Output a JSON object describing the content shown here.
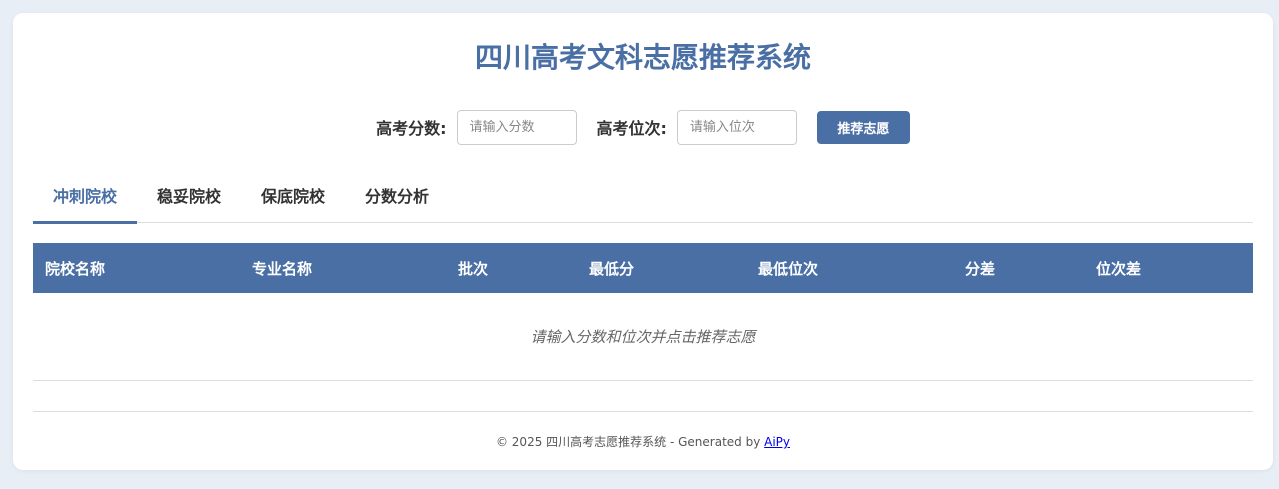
{
  "header": {
    "title": "四川高考文科志愿推荐系统"
  },
  "form": {
    "score_label": "高考分数:",
    "score_value": "",
    "score_placeholder": "请输入分数",
    "rank_label": "高考位次:",
    "rank_value": "",
    "rank_placeholder": "请输入位次",
    "submit_label": "推荐志愿"
  },
  "tabs": [
    {
      "label": "冲刺院校",
      "active": true
    },
    {
      "label": "稳妥院校",
      "active": false
    },
    {
      "label": "保底院校",
      "active": false
    },
    {
      "label": "分数分析",
      "active": false
    }
  ],
  "table": {
    "headers": [
      "院校名称",
      "专业名称",
      "批次",
      "最低分",
      "最低位次",
      "分差",
      "位次差"
    ],
    "rows": [],
    "empty_message": "请输入分数和位次并点击推荐志愿"
  },
  "footer": {
    "text": "© 2025 四川高考志愿推荐系统 - Generated by ",
    "link_label": "AiPy"
  },
  "colors": {
    "accent": "#4a6fa5",
    "background": "#e8eef5",
    "card": "#ffffff"
  }
}
